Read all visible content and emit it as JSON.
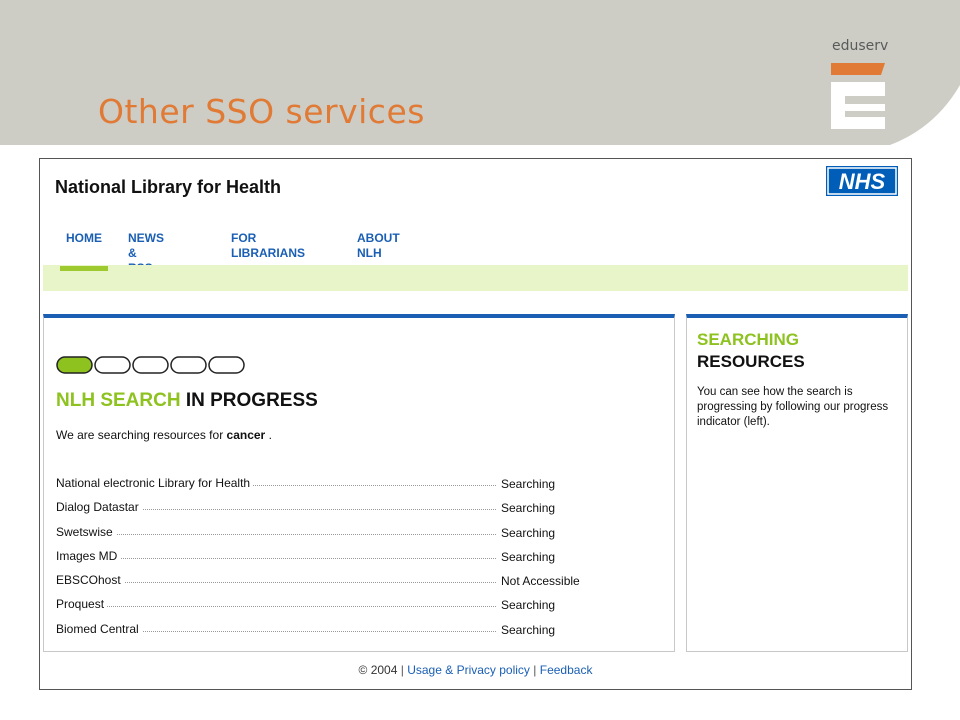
{
  "slide": {
    "title": "Other SSO services",
    "brand": "eduserv",
    "colors": {
      "band": "#cdcdc6",
      "title": "#e07a35",
      "logo_accent": "#e07a35"
    }
  },
  "site": {
    "title": "National Library for Health",
    "logo_text": "NHS",
    "nav": [
      {
        "label_line1": "HOME",
        "label_line2": ""
      },
      {
        "label_line1": "NEWS &",
        "label_line2": "RSS"
      },
      {
        "label_line1": "FOR",
        "label_line2": "LIBRARIANS"
      },
      {
        "label_line1": "ABOUT",
        "label_line2": "NLH"
      }
    ],
    "colors": {
      "link": "#1a5fb4",
      "accent_green": "#8dc21f",
      "light_green": "#e8f5c8",
      "nhs_blue": "#005eb8"
    }
  },
  "main": {
    "progress": {
      "steps_total": 5,
      "steps_complete": 1
    },
    "heading_green": "NLH SEARCH",
    "heading_dark": "IN PROGRESS",
    "desc_prefix": "We are searching resources for",
    "desc_term": "cancer",
    "desc_suffix": ".",
    "resources": [
      {
        "name": "National electronic Library for Health",
        "status": "Searching"
      },
      {
        "name": "Dialog Datastar",
        "status": "Searching"
      },
      {
        "name": "Swetswise",
        "status": "Searching"
      },
      {
        "name": "Images MD",
        "status": "Searching"
      },
      {
        "name": "EBSCOhost",
        "status": "Not Accessible"
      },
      {
        "name": "Proquest",
        "status": "Searching"
      },
      {
        "name": "Biomed Central",
        "status": "Searching"
      }
    ]
  },
  "side": {
    "heading_green": "SEARCHING",
    "heading_dark": "RESOURCES",
    "text": "You can see how the search is progressing by following our progress indicator (left)."
  },
  "footer": {
    "copyright": "© 2004",
    "sep1": "|",
    "privacy_link": "Usage & Privacy policy",
    "sep2": "|",
    "feedback_link": "Feedback"
  }
}
